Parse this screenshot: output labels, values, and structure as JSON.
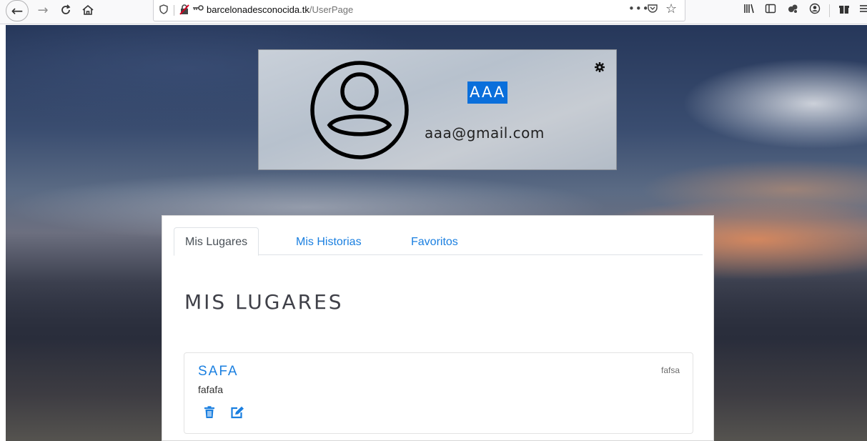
{
  "browser": {
    "url_host": "barcelonadesconocida.tk",
    "url_path": "/UserPage",
    "icons": {
      "back": "back-arrow-icon",
      "forward": "forward-arrow-icon",
      "reload": "reload-icon",
      "home": "home-icon",
      "more": "more-actions-icon",
      "pocket": "pocket-icon",
      "bookmark": "bookmark-star-icon"
    },
    "glyphs": {
      "back": "←",
      "forward": "→",
      "reload": "C",
      "home": "⌂",
      "shield": "⛉",
      "insecure": "⚠",
      "key": "⊸",
      "more": "•••",
      "pocket": "⋓",
      "star": "☆",
      "library": "|||\\",
      "sidebar": "◫",
      "extension": "❖",
      "account": "◉",
      "gift": "▦",
      "menu": "≡"
    }
  },
  "profile": {
    "name": "AAA",
    "email": "aaa@gmail.com",
    "cursor_glyph": "I",
    "gear_glyph": "✱"
  },
  "tabs": [
    {
      "label": "Mis Lugares",
      "active": true
    },
    {
      "label": "Mis Historias",
      "active": false
    },
    {
      "label": "Favoritos",
      "active": false
    }
  ],
  "section": {
    "title": "MIS LUGARES"
  },
  "places": [
    {
      "title": "SAFA",
      "meta": "fafsa",
      "description": "fafafa"
    }
  ],
  "colors": {
    "accent": "#1a7fe0",
    "selection": "#0a6fdb",
    "panel_border": "#d6d6d6"
  }
}
